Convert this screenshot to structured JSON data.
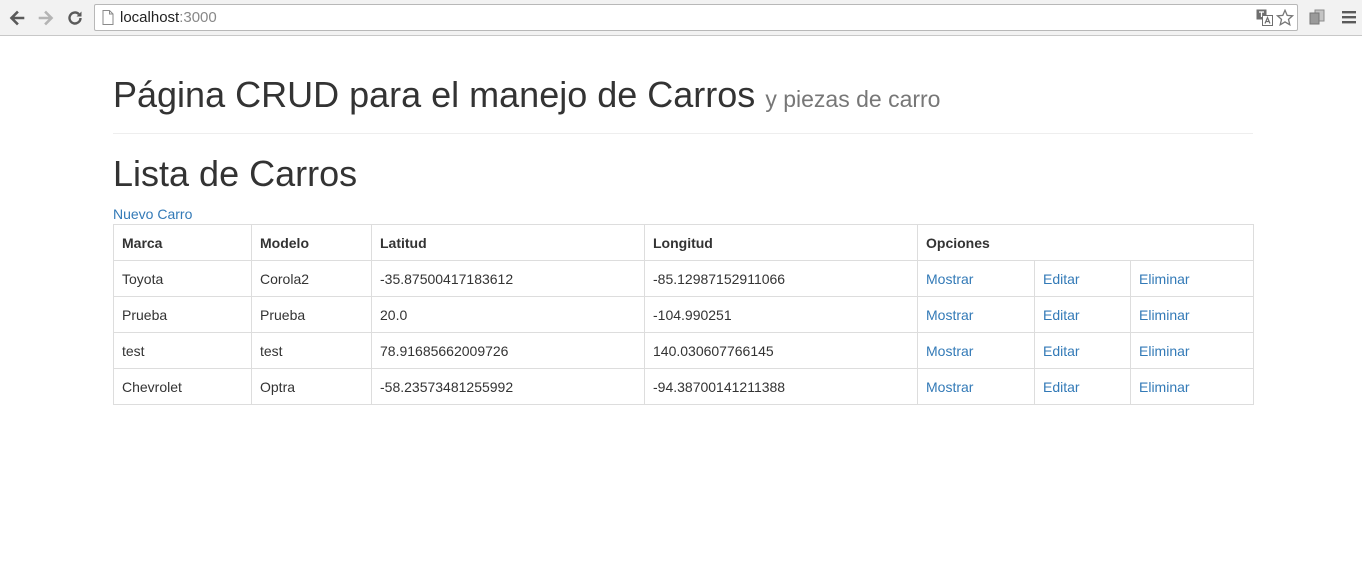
{
  "browser": {
    "url_host": "localhost",
    "url_port": ":3000"
  },
  "header": {
    "title": "Página CRUD para el manejo de Carros",
    "subtitle": "y piezas de carro"
  },
  "section": {
    "title": "Lista de Carros",
    "new_link": "Nuevo Carro"
  },
  "table": {
    "columns": [
      "Marca",
      "Modelo",
      "Latitud",
      "Longitud",
      "Opciones"
    ],
    "rows": [
      {
        "marca": "Toyota",
        "modelo": "Corola2",
        "latitud": "-35.87500417183612",
        "longitud": "-85.12987152911066"
      },
      {
        "marca": "Prueba",
        "modelo": "Prueba",
        "latitud": "20.0",
        "longitud": "-104.990251"
      },
      {
        "marca": "test",
        "modelo": "test",
        "latitud": "78.91685662009726",
        "longitud": "140.030607766145"
      },
      {
        "marca": "Chevrolet",
        "modelo": "Optra",
        "latitud": "-58.23573481255992",
        "longitud": "-94.38700141211388"
      }
    ],
    "actions": {
      "show": "Mostrar",
      "edit": "Editar",
      "delete": "Eliminar"
    }
  },
  "colors": {
    "link": "#337ab7",
    "text": "#333333",
    "muted": "#777777",
    "border": "#dddddd"
  }
}
